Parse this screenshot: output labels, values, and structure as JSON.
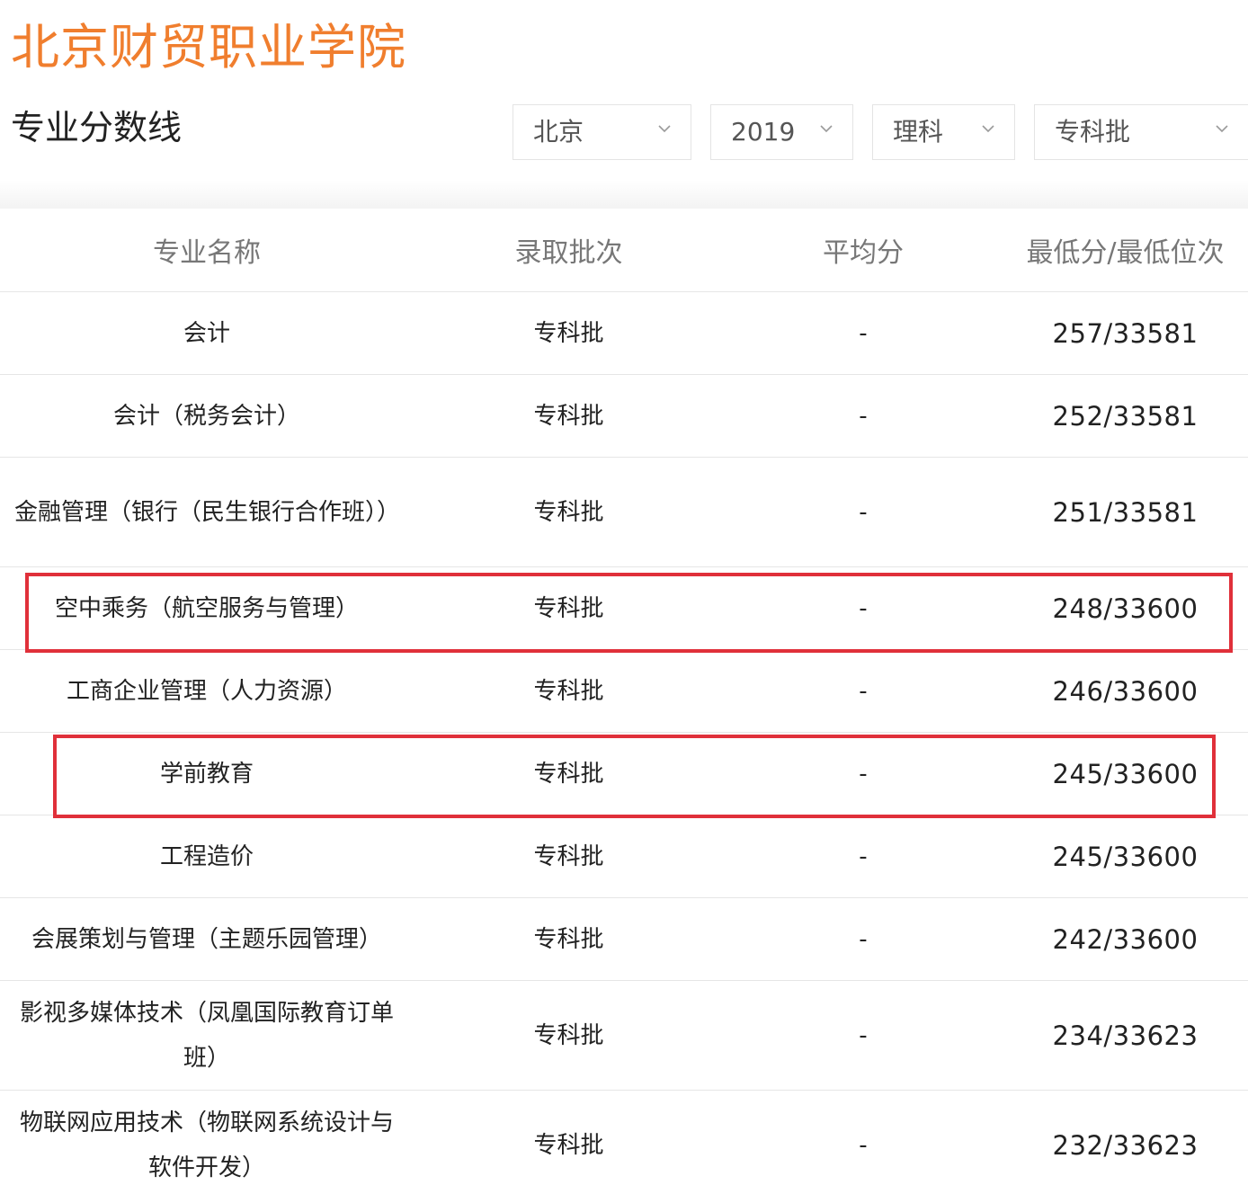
{
  "header": {
    "school_name": "北京财贸职业学院",
    "section_title": "专业分数线"
  },
  "filters": {
    "province": "北京",
    "year": "2019",
    "subject": "理科",
    "batch": "专科批"
  },
  "table": {
    "columns": [
      "专业名称",
      "录取批次",
      "平均分",
      "最低分/最低位次"
    ],
    "rows": [
      {
        "major": "会计",
        "batch": "专科批",
        "avg": "-",
        "min_score_rank": "257/33581",
        "highlighted": false
      },
      {
        "major": "会计（税务会计）",
        "batch": "专科批",
        "avg": "-",
        "min_score_rank": "252/33581",
        "highlighted": false
      },
      {
        "major": "金融管理（银行（民生银行合作班））",
        "batch": "专科批",
        "avg": "-",
        "min_score_rank": "251/33581",
        "highlighted": false
      },
      {
        "major": "空中乘务（航空服务与管理）",
        "batch": "专科批",
        "avg": "-",
        "min_score_rank": "248/33600",
        "highlighted": true
      },
      {
        "major": "工商企业管理（人力资源）",
        "batch": "专科批",
        "avg": "-",
        "min_score_rank": "246/33600",
        "highlighted": false
      },
      {
        "major": "学前教育",
        "batch": "专科批",
        "avg": "-",
        "min_score_rank": "245/33600",
        "highlighted": true
      },
      {
        "major": "工程造价",
        "batch": "专科批",
        "avg": "-",
        "min_score_rank": "245/33600",
        "highlighted": false
      },
      {
        "major": "会展策划与管理（主题乐园管理）",
        "batch": "专科批",
        "avg": "-",
        "min_score_rank": "242/33600",
        "highlighted": false
      },
      {
        "major": "影视多媒体技术（凤凰国际教育订单班）",
        "batch": "专科批",
        "avg": "-",
        "min_score_rank": "234/33623",
        "highlighted": false
      },
      {
        "major": "物联网应用技术（物联网系统设计与软件开发）",
        "batch": "专科批",
        "avg": "-",
        "min_score_rank": "232/33623",
        "highlighted": false
      }
    ]
  },
  "colors": {
    "brand_orange": "#f07e2e",
    "highlight_red": "#e0303a"
  }
}
